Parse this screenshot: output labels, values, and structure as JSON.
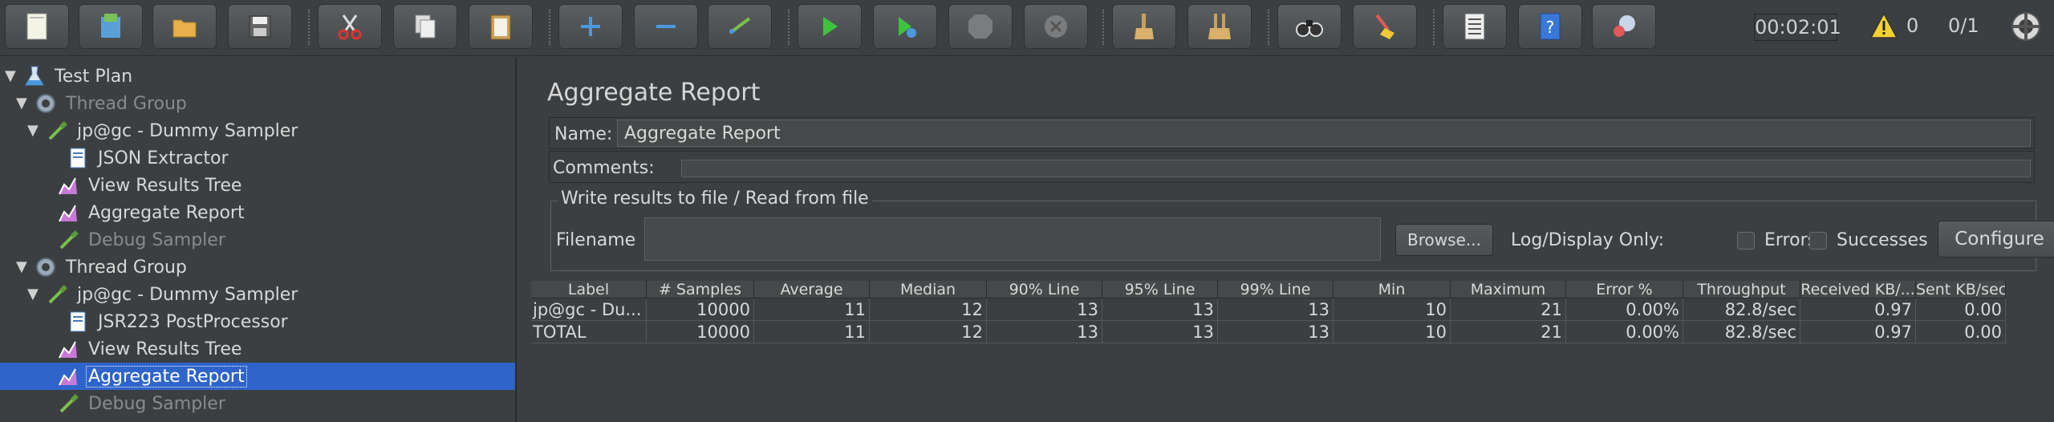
{
  "toolbar": {
    "timer": "00:02:01",
    "warning_count": "0",
    "threads": "0/1"
  },
  "tree": [
    {
      "label": "Test Plan",
      "icon": "flask-icon",
      "state": "normal",
      "twisty": "▼"
    },
    {
      "label": "Thread Group",
      "icon": "gear-icon",
      "state": "disabled",
      "twisty": "▼"
    },
    {
      "label": "jp@gc - Dummy Sampler",
      "icon": "pipette-icon",
      "state": "normal",
      "twisty": "▼"
    },
    {
      "label": "JSON Extractor",
      "icon": "document-icon",
      "state": "normal",
      "twisty": ""
    },
    {
      "label": "View Results Tree",
      "icon": "chart-icon",
      "state": "normal",
      "twisty": ""
    },
    {
      "label": "Aggregate Report",
      "icon": "chart-icon",
      "state": "normal",
      "twisty": ""
    },
    {
      "label": "Debug Sampler",
      "icon": "pipette-icon",
      "state": "disabled",
      "twisty": ""
    },
    {
      "label": "Thread Group",
      "icon": "gear-icon",
      "state": "normal",
      "twisty": "▼"
    },
    {
      "label": "jp@gc - Dummy Sampler",
      "icon": "pipette-icon",
      "state": "normal",
      "twisty": "▼"
    },
    {
      "label": "JSR223 PostProcessor",
      "icon": "document-icon",
      "state": "normal",
      "twisty": ""
    },
    {
      "label": "View Results Tree",
      "icon": "chart-icon",
      "state": "normal",
      "twisty": ""
    },
    {
      "label": "Aggregate Report",
      "icon": "chart-icon",
      "state": "selected",
      "twisty": ""
    },
    {
      "label": "Debug Sampler",
      "icon": "pipette-icon",
      "state": "disabled",
      "twisty": ""
    }
  ],
  "panel": {
    "title": "Aggregate Report",
    "name_label": "Name:",
    "name_value": "Aggregate Report",
    "comments_label": "Comments:",
    "file_legend": "Write results to file / Read from file",
    "filename_label": "Filename",
    "browse_label": "Browse...",
    "log_label": "Log/Display Only:",
    "errors_label": "Errors",
    "successes_label": "Successes",
    "configure_label": "Configure"
  },
  "table": {
    "columns": [
      "Label",
      "# Samples",
      "Average",
      "Median",
      "90% Line",
      "95% Line",
      "99% Line",
      "Min",
      "Maximum",
      "Error %",
      "Throughput",
      "Received KB/...",
      "Sent KB/sec"
    ],
    "rows": [
      [
        "jp@gc - Du...",
        "10000",
        "11",
        "12",
        "13",
        "13",
        "13",
        "10",
        "21",
        "0.00%",
        "82.8/sec",
        "0.97",
        "0.00"
      ],
      [
        "TOTAL",
        "10000",
        "11",
        "12",
        "13",
        "13",
        "13",
        "10",
        "21",
        "0.00%",
        "82.8/sec",
        "0.97",
        "0.00"
      ]
    ]
  }
}
